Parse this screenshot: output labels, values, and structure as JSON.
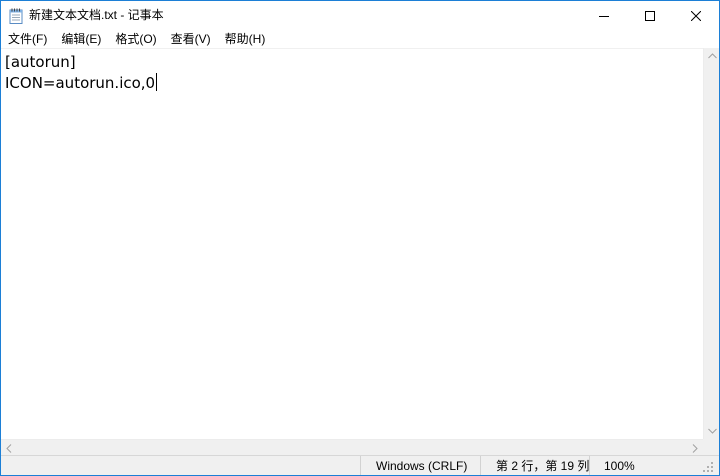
{
  "window": {
    "title": "新建文本文档.txt - 记事本",
    "border_color": "#1c7fd6",
    "app_icon": "notepad-icon"
  },
  "caption_buttons": {
    "minimize_icon": "minimize-icon",
    "maximize_icon": "maximize-icon",
    "close_icon": "close-icon"
  },
  "menu": {
    "items": [
      {
        "label": "文件(F)"
      },
      {
        "label": "编辑(E)"
      },
      {
        "label": "格式(O)"
      },
      {
        "label": "查看(V)"
      },
      {
        "label": "帮助(H)"
      }
    ]
  },
  "editor": {
    "lines": [
      "[autorun]",
      "ICON=autorun.ico,0"
    ]
  },
  "statusbar": {
    "encoding": "Windows (CRLF)",
    "position": "第 2 行，第 19 列",
    "zoom": "100%"
  }
}
